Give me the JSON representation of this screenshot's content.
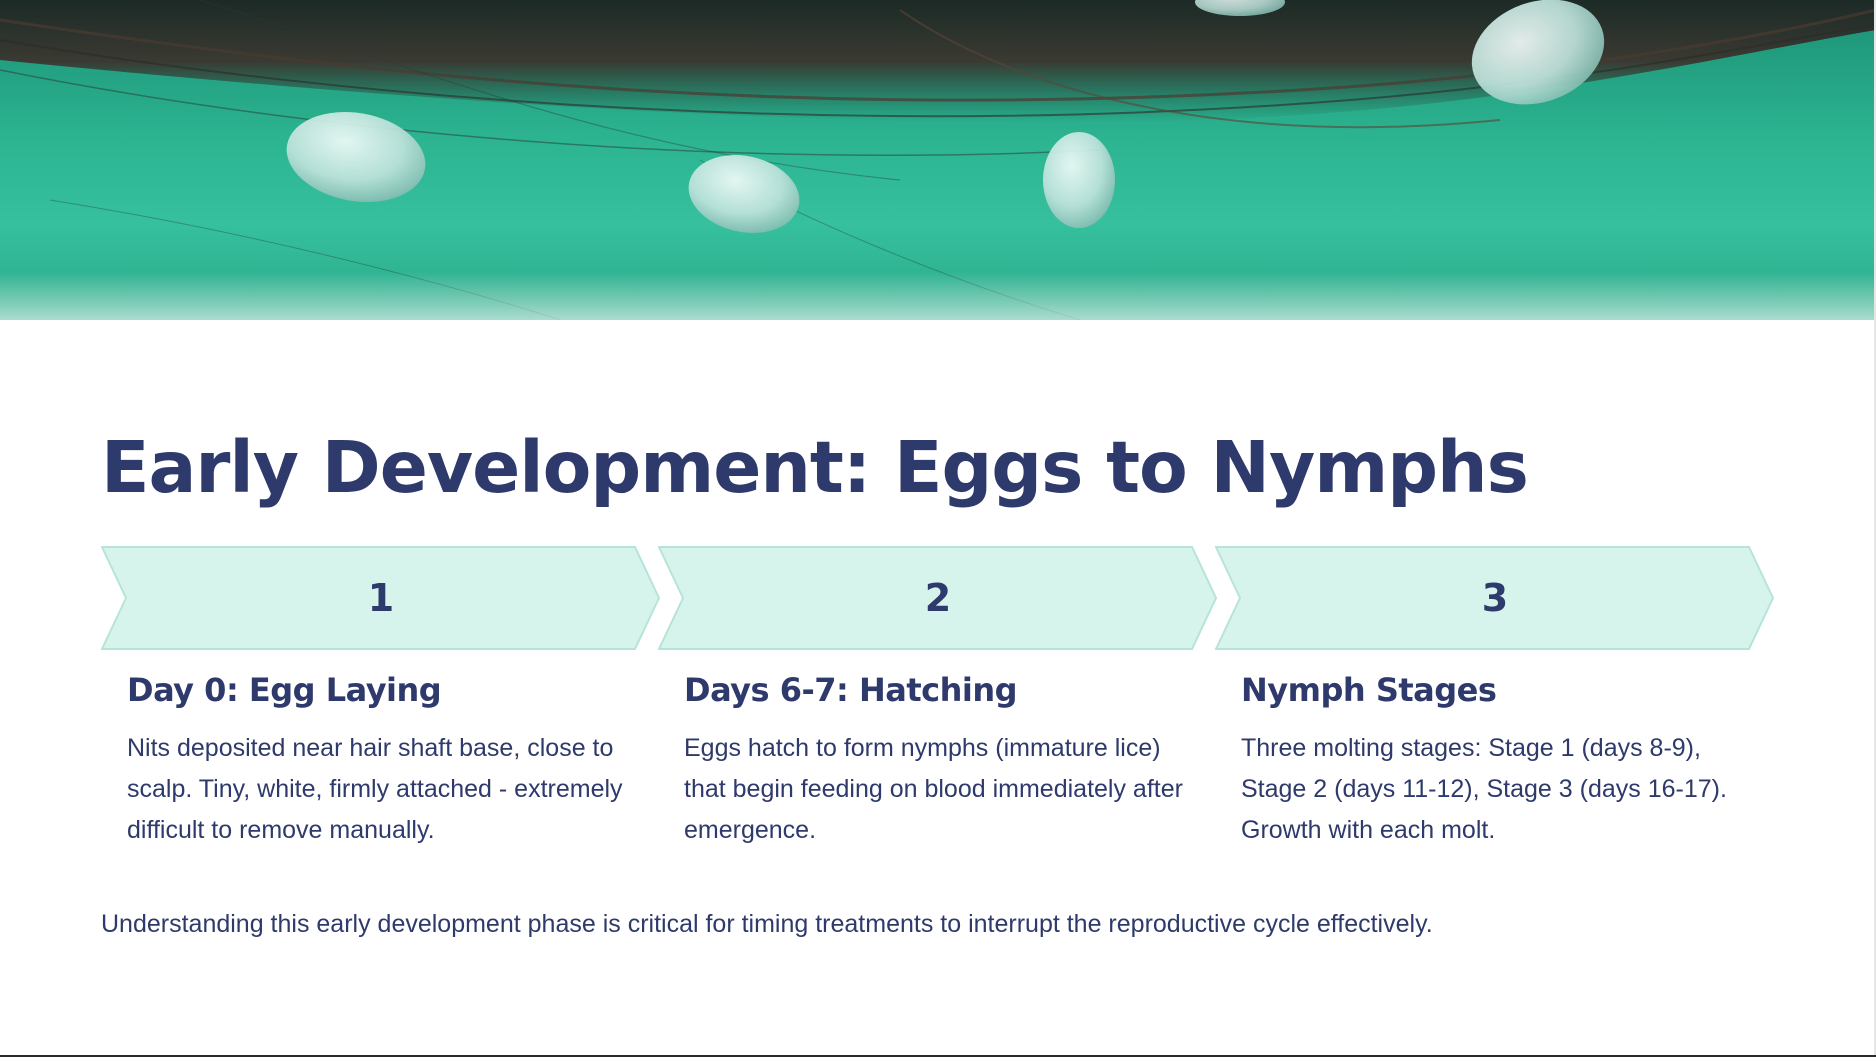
{
  "slide": {
    "title": "Early Development: Eggs to Nymphs",
    "hero_image": "close-up of lice nits attached to hair strands on teal background",
    "colors": {
      "primary_text": "#2e3a6b",
      "chevron_fill": "#d6f3ec",
      "chevron_stroke": "#b7e4d8",
      "hero_teal": "#2db592"
    },
    "steps": [
      {
        "number": "1",
        "title": "Day 0: Egg Laying",
        "description": "Nits deposited near hair shaft base, close to scalp. Tiny, white, firmly attached - extremely difficult to remove manually."
      },
      {
        "number": "2",
        "title": "Days 6-7: Hatching",
        "description": "Eggs hatch to form nymphs (immature lice) that begin feeding on blood immediately after emergence."
      },
      {
        "number": "3",
        "title": "Nymph Stages",
        "description": "Three molting stages: Stage 1 (days 8-9), Stage 2 (days 11-12), Stage 3 (days 16-17). Growth with each molt."
      }
    ],
    "footer_note": "Understanding this early development phase is critical for timing treatments to interrupt the reproductive cycle effectively."
  }
}
